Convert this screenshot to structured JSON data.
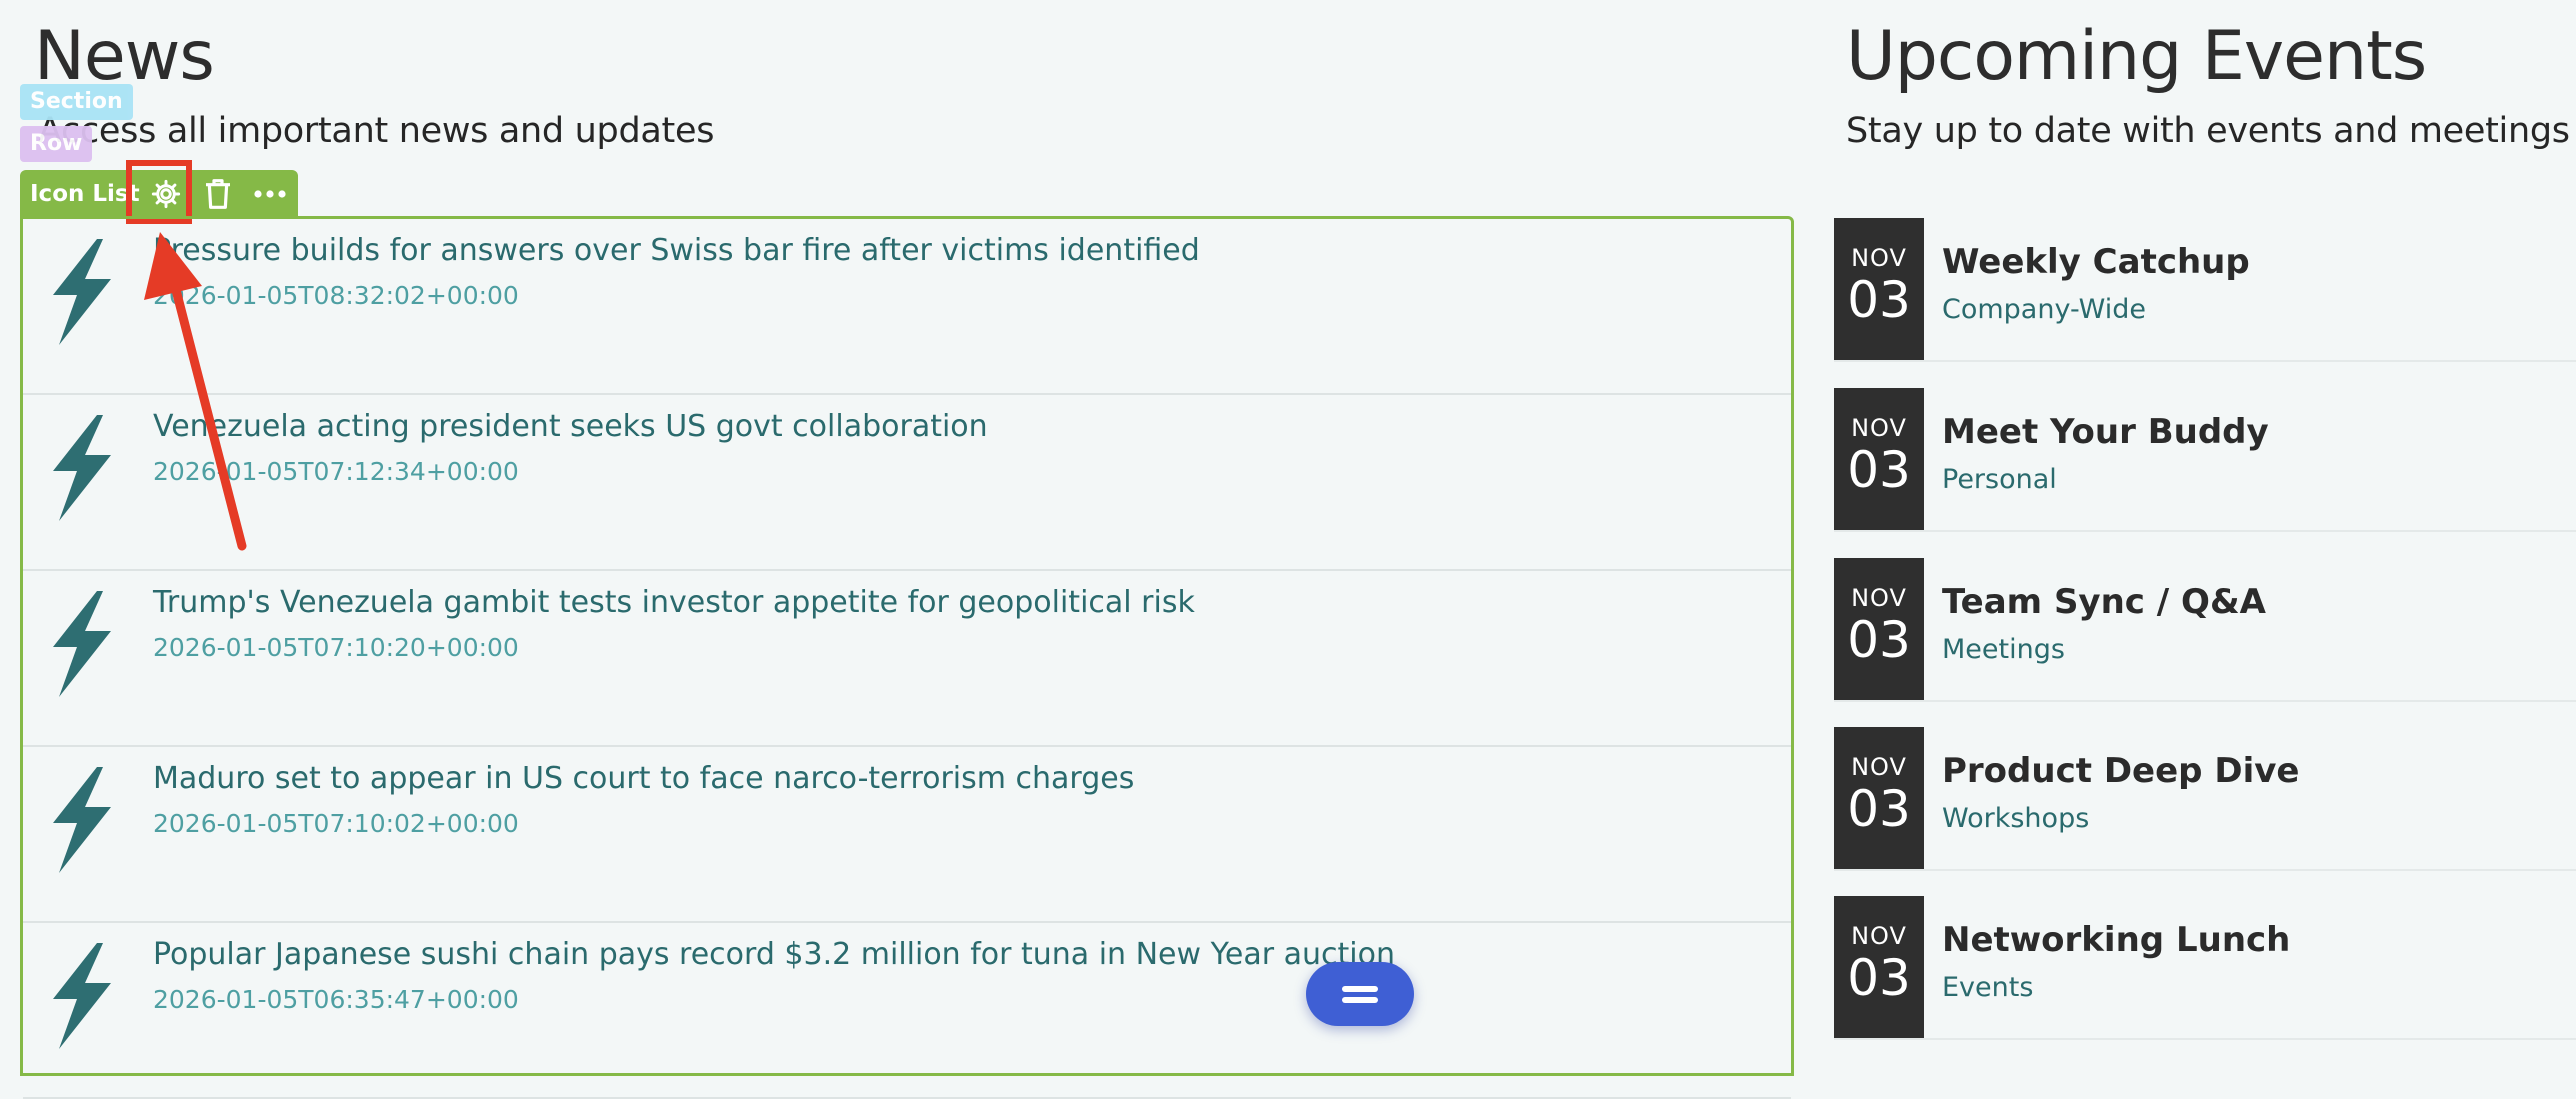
{
  "news": {
    "title": "News",
    "subtitle": "Access all important news and updates",
    "items": [
      {
        "headline": "Pressure builds for answers over Swiss bar fire after victims identified",
        "date": "2026-01-05T08:32:02+00:00"
      },
      {
        "headline": "Venezuela acting president seeks US govt collaboration",
        "date": "2026-01-05T07:12:34+00:00"
      },
      {
        "headline": "Trump's Venezuela gambit tests investor appetite for geopolitical risk",
        "date": "2026-01-05T07:10:20+00:00"
      },
      {
        "headline": "Maduro set to appear in US court to face narco-terrorism charges",
        "date": "2026-01-05T07:10:02+00:00"
      },
      {
        "headline": "Popular Japanese sushi chain pays record $3.2 million for tuna in New Year auction",
        "date": "2026-01-05T06:35:47+00:00"
      }
    ]
  },
  "editor": {
    "section_tag": "Section",
    "row_tag": "Row",
    "widget_label": "Icon List",
    "settings_icon": "gear-icon",
    "delete_icon": "trash-icon",
    "more_icon": "more-horizontal-icon",
    "accent_color": "#85b947",
    "highlight_color": "#e53b26"
  },
  "fab": {
    "icon": "menu-equals-icon",
    "color": "#3f5fd4"
  },
  "events": {
    "title": "Upcoming Events",
    "subtitle": "Stay up to date with events and meetings",
    "items": [
      {
        "month": "NOV",
        "day": "03",
        "name": "Weekly Catchup",
        "category": "Company-Wide"
      },
      {
        "month": "NOV",
        "day": "03",
        "name": "Meet Your Buddy",
        "category": "Personal"
      },
      {
        "month": "NOV",
        "day": "03",
        "name": "Team Sync / Q&A",
        "category": "Meetings"
      },
      {
        "month": "NOV",
        "day": "03",
        "name": "Product Deep Dive",
        "category": "Workshops"
      },
      {
        "month": "NOV",
        "day": "03",
        "name": "Networking Lunch",
        "category": "Events"
      }
    ]
  }
}
